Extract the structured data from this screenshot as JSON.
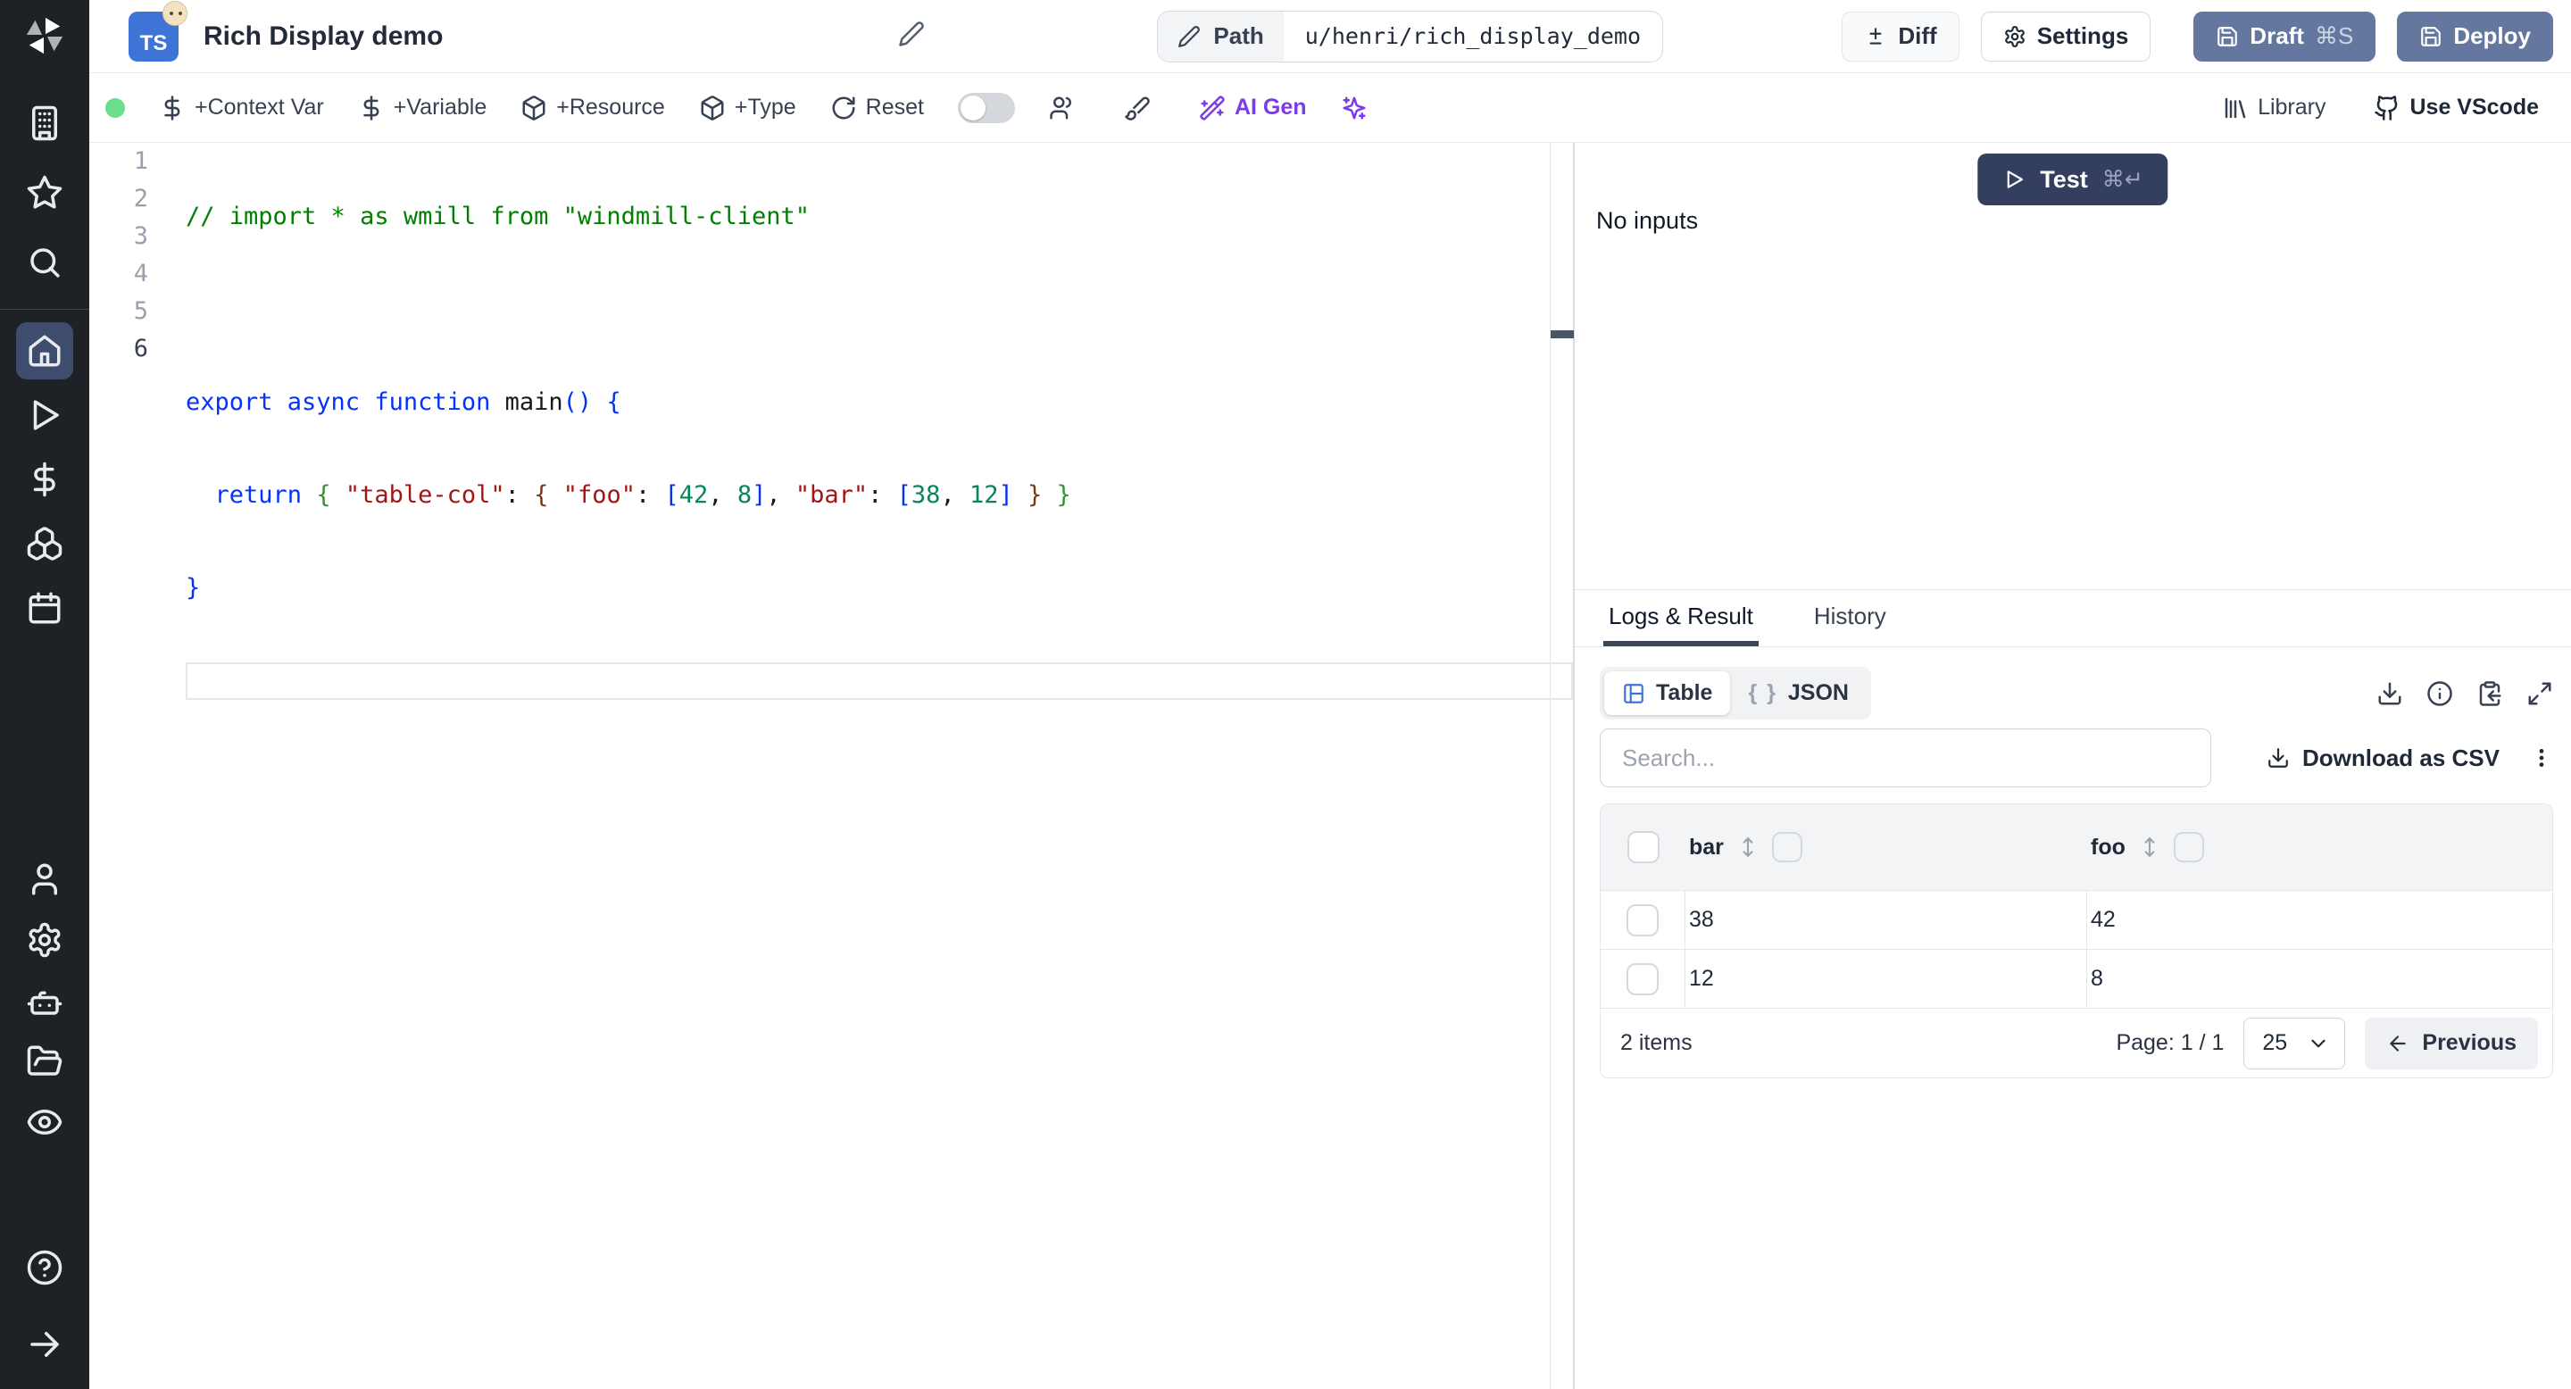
{
  "colors": {
    "accent_slate": "#64779e",
    "test_navy": "#343e5e",
    "ai_purple": "#7c3aed",
    "table_icon_blue": "#3f74d6",
    "status_green": "#69de8c",
    "sidebar_bg": "#1e2126",
    "sidebar_active": "#3e4c6e"
  },
  "sidebar": {
    "icons": [
      "windmill-logo",
      "building",
      "star",
      "search",
      "home",
      "play",
      "dollar",
      "boxes",
      "calendar",
      "user",
      "settings",
      "robot",
      "folder",
      "eye",
      "help-circle",
      "arrow-right"
    ]
  },
  "header": {
    "lang_badge": "TS",
    "title": "Rich Display demo",
    "path_label": "Path",
    "path_value": "u/henri/rich_display_demo",
    "diff_label": "Diff",
    "settings_label": "Settings",
    "draft_label": "Draft",
    "draft_kbd": "⌘S",
    "deploy_label": "Deploy"
  },
  "toolbar": {
    "context_var": "+Context Var",
    "variable": "+Variable",
    "resource": "+Resource",
    "type": "+Type",
    "reset": "Reset",
    "ai_gen": "AI Gen",
    "library": "Library",
    "vscode": "Use VScode"
  },
  "editor": {
    "line_numbers": [
      "1",
      "2",
      "3",
      "4",
      "5",
      "6"
    ],
    "l1": {
      "comment": "// import * as wmill from \"windmill-client\""
    },
    "l3": {
      "kw": "export async function",
      "sp": " ",
      "fn": "main",
      "b": "() {"
    },
    "l4": {
      "t01": "  ",
      "t02": "return",
      "t03": " ",
      "t04": "{",
      "t05": " ",
      "t06": "\"table-col\"",
      "t07": ": ",
      "t08": "{",
      "t09": " ",
      "t10": "\"foo\"",
      "t11": ": ",
      "t12": "[",
      "t13": "42",
      "t14": ", ",
      "t15": "8",
      "t16": "]",
      "t17": ", ",
      "t18": "\"bar\"",
      "t19": ": ",
      "t20": "[",
      "t21": "38",
      "t22": ", ",
      "t23": "12",
      "t24": "]",
      "t25": " ",
      "t26": "}",
      "t27": " ",
      "t28": "}"
    },
    "l5": {
      "b": "}"
    }
  },
  "panel": {
    "test_label": "Test",
    "test_kbd": "⌘↵",
    "no_inputs": "No inputs",
    "tabs": [
      {
        "label": "Logs & Result"
      },
      {
        "label": "History"
      }
    ]
  },
  "result": {
    "view_table": "Table",
    "view_json_braces": "{ }",
    "view_json": "JSON",
    "search_placeholder": "Search...",
    "download_csv": "Download as CSV",
    "table": {
      "columns": [
        {
          "label": "bar"
        },
        {
          "label": "foo"
        }
      ],
      "rows": [
        {
          "bar": "38",
          "foo": "42"
        },
        {
          "bar": "12",
          "foo": "8"
        }
      ],
      "footer": {
        "count": "2 items",
        "page": "Page: 1 / 1",
        "page_size": "25",
        "prev": "Previous"
      }
    }
  }
}
